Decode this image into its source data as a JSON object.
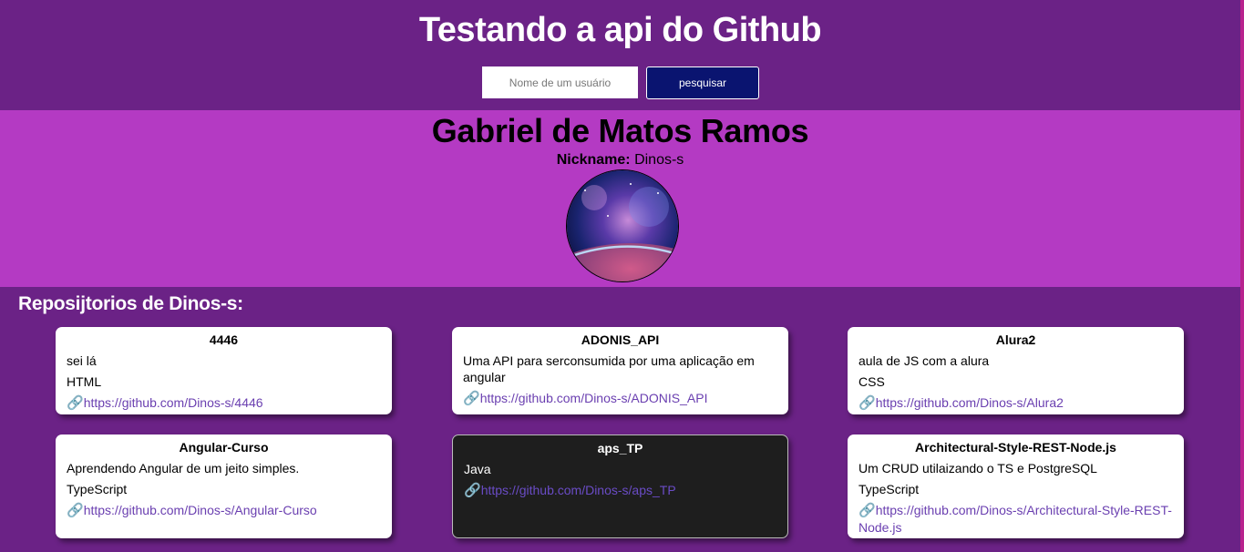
{
  "header": {
    "title": "Testando a api do Github",
    "search_placeholder": "Nome de um usuário",
    "search_button": "pesquisar"
  },
  "profile": {
    "name": "Gabriel de Matos Ramos",
    "nickname_label": "Nickname:",
    "nickname": "Dinos-s"
  },
  "repos": {
    "title": "Reposijtorios de Dinos-s:",
    "link_icon": "🔗",
    "items": [
      {
        "name": "4446",
        "description": "sei lá",
        "language": "HTML",
        "url": "https://github.com/Dinos-s/4446"
      },
      {
        "name": "ADONIS_API",
        "description": "Uma API para serconsumida por uma aplicação em angular",
        "language": "",
        "url": "https://github.com/Dinos-s/ADONIS_API"
      },
      {
        "name": "Alura2",
        "description": "aula de JS com a alura",
        "language": "CSS",
        "url": "https://github.com/Dinos-s/Alura2"
      },
      {
        "name": "Angular-Curso",
        "description": "Aprendendo Angular de um jeito simples.",
        "language": "TypeScript",
        "url": "https://github.com/Dinos-s/Angular-Curso"
      },
      {
        "name": "aps_TP",
        "description": "",
        "language": "Java",
        "url": "https://github.com/Dinos-s/aps_TP"
      },
      {
        "name": "Architectural-Style-REST-Node.js",
        "description": "Um CRUD utilaizando o TS e PostgreSQL",
        "language": "TypeScript",
        "url": "https://github.com/Dinos-s/Architectural-Style-REST-Node.js"
      }
    ]
  },
  "colors": {
    "page_background": "#6b2286",
    "profile_background": "#b43ac3",
    "button_background": "#0a1470",
    "link": "#6a3fb0"
  }
}
